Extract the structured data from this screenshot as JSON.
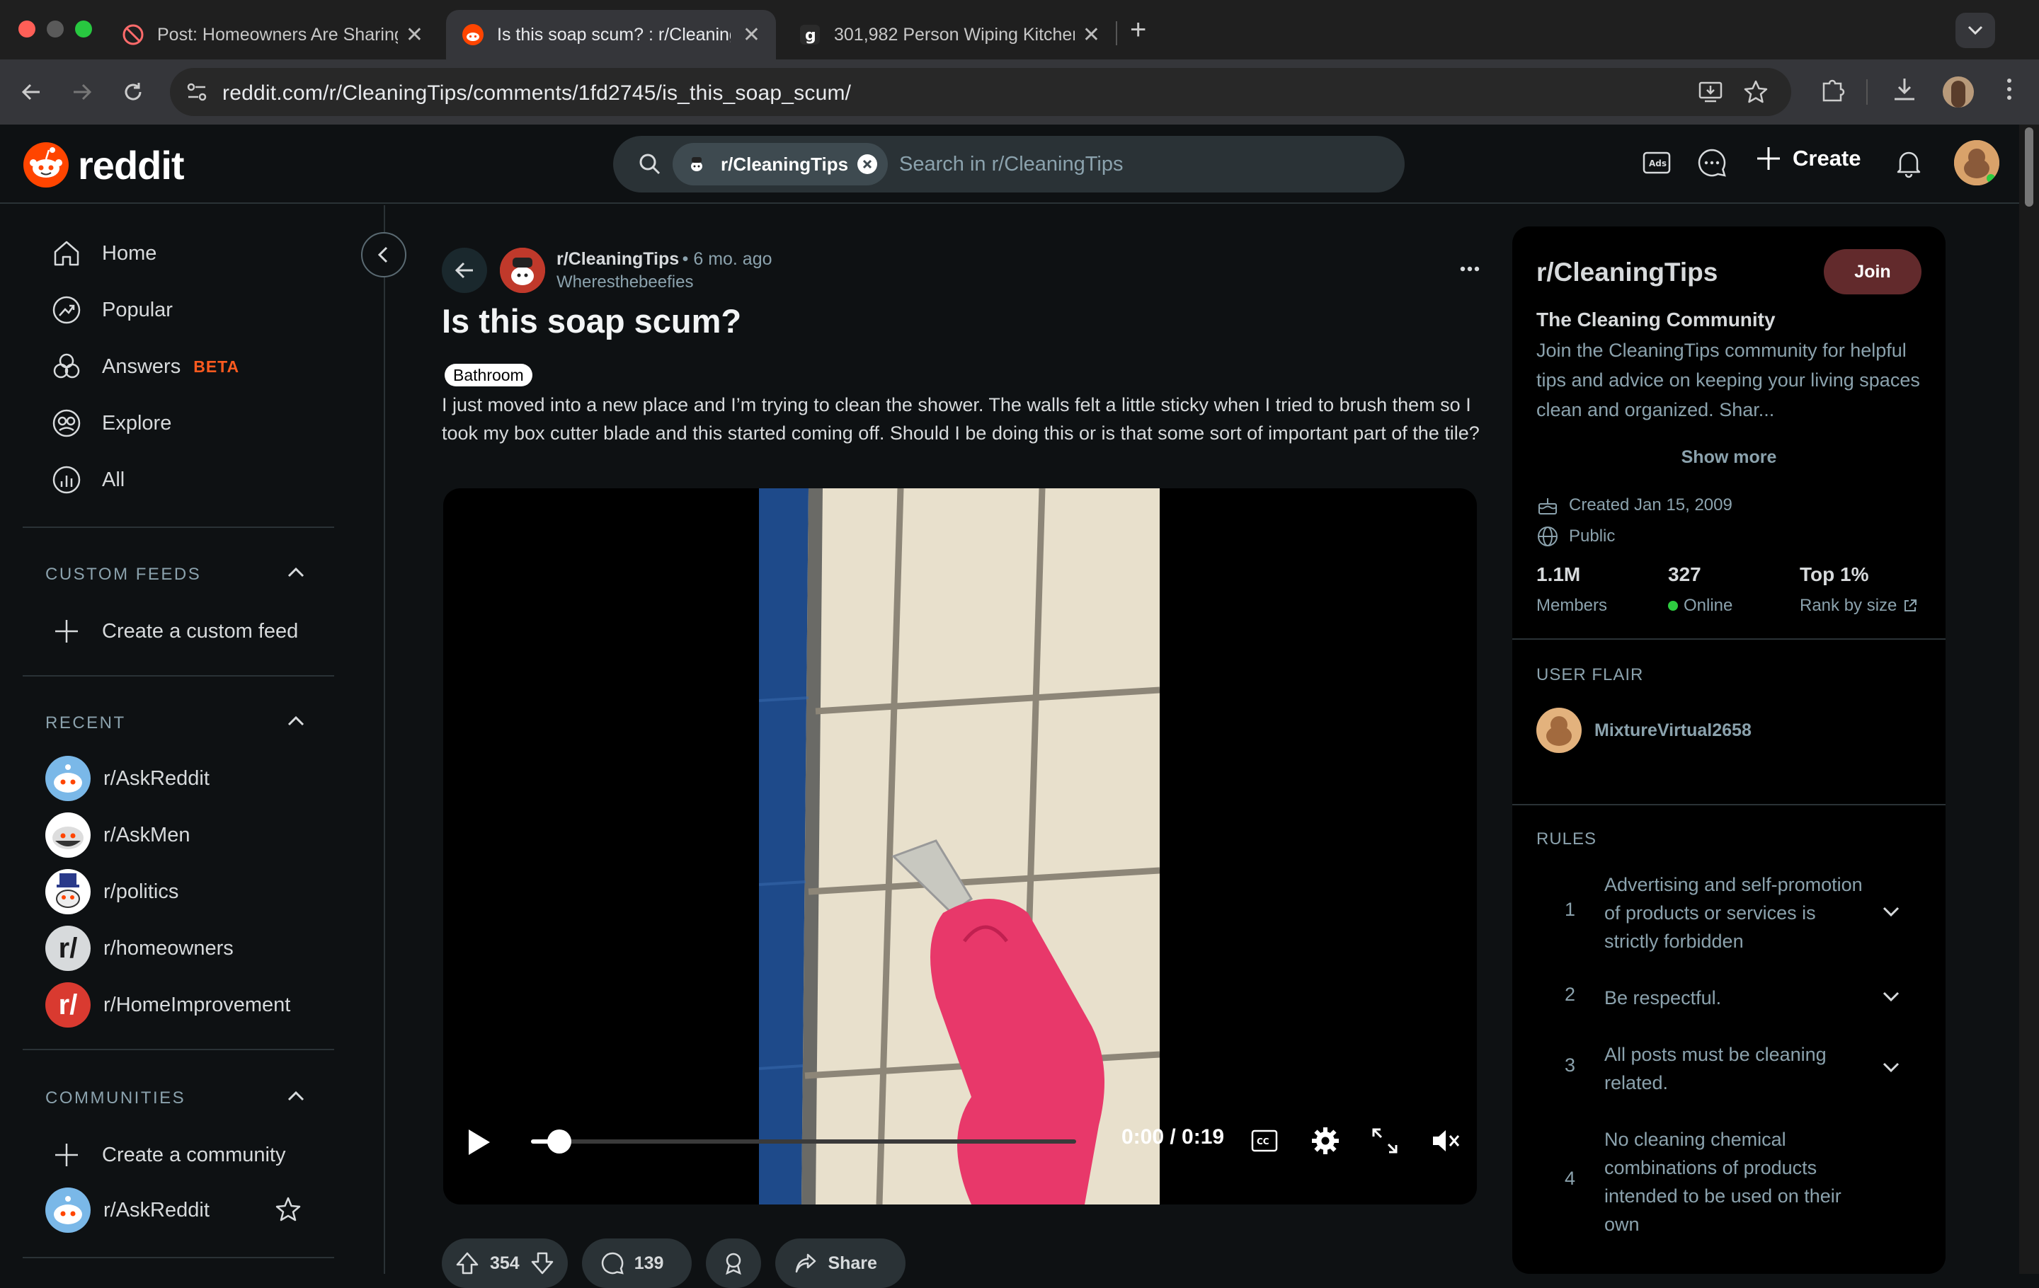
{
  "browser": {
    "tabs": [
      {
        "title": "Post: Homeowners Are Sharing",
        "active": false
      },
      {
        "title": "Is this soap scum? : r/CleaningTips",
        "active": true
      },
      {
        "title": "301,982 Person Wiping Kitchen",
        "active": false
      }
    ],
    "url": "reddit.com/r/CleaningTips/comments/1fd2745/is_this_soap_scum/"
  },
  "header": {
    "logo_text": "reddit",
    "search_chip": "r/CleaningTips",
    "search_placeholder": "Search in r/CleaningTips",
    "create_label": "Create"
  },
  "sidebar": {
    "nav": [
      {
        "label": "Home",
        "icon": "home-icon"
      },
      {
        "label": "Popular",
        "icon": "popular-icon"
      },
      {
        "label": "Answers",
        "icon": "answers-icon",
        "badge": "BETA"
      },
      {
        "label": "Explore",
        "icon": "explore-icon"
      },
      {
        "label": "All",
        "icon": "all-icon"
      }
    ],
    "custom_feeds_title": "CUSTOM FEEDS",
    "create_custom_feed": "Create a custom feed",
    "recent_title": "RECENT",
    "recent": [
      "r/AskReddit",
      "r/AskMen",
      "r/politics",
      "r/homeowners",
      "r/HomeImprovement"
    ],
    "communities_title": "COMMUNITIES",
    "create_community": "Create a community",
    "communities": [
      "r/AskReddit"
    ]
  },
  "post": {
    "subreddit": "r/CleaningTips",
    "age": "• 6 mo. ago",
    "author": "Wheresthebeefies",
    "title": "Is this soap scum?",
    "flair": "Bathroom",
    "body": "I just moved into a new place and I’m trying to clean the shower. The walls felt a little sticky when I tried to brush them so I took my box cutter blade and this started coming off. Should I be doing this or is that some sort of important part of the tile?",
    "video_time": "0:00 / 0:19",
    "video_progress": 0.03,
    "upvotes": "354",
    "comments": "139",
    "share_label": "Share"
  },
  "community": {
    "name": "r/CleaningTips",
    "join_label": "Join",
    "title": "The Cleaning Community",
    "description": "Join the CleaningTips community for helpful tips and advice on keeping your living spaces clean and organized. Shar...",
    "show_more": "Show more",
    "created": "Created Jan 15, 2009",
    "visibility": "Public",
    "stats": [
      {
        "value": "1.1M",
        "label": "Members"
      },
      {
        "value": "327",
        "label": "Online"
      },
      {
        "value": "Top 1%",
        "label": "Rank by size"
      }
    ],
    "user_flair_title": "USER FLAIR",
    "user_flair_name": "MixtureVirtual2658",
    "rules_title": "RULES",
    "rules": [
      {
        "num": "1",
        "text": "Advertising and self-promotion of products or services is strictly forbidden"
      },
      {
        "num": "2",
        "text": "Be respectful."
      },
      {
        "num": "3",
        "text": "All posts must be cleaning related."
      },
      {
        "num": "4",
        "text": "No cleaning chemical combinations of products intended to be used on their own"
      }
    ]
  },
  "colors": {
    "reddit_orange": "#ff4500",
    "join_bg": "#622a2c",
    "online_green": "#2ecc40"
  }
}
